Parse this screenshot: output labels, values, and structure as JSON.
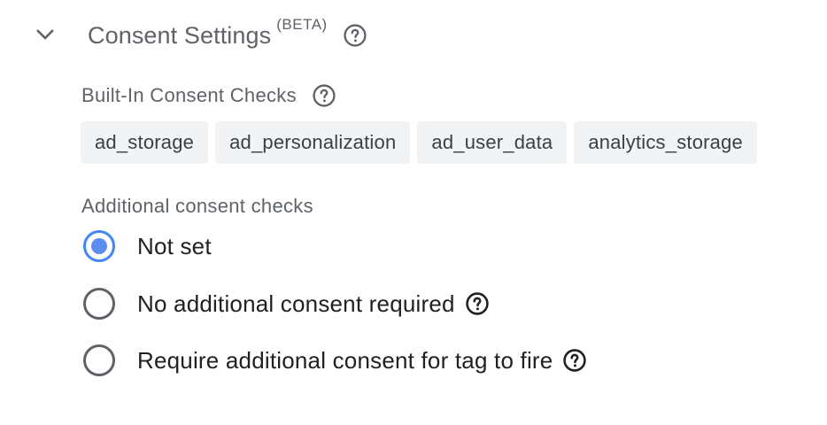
{
  "section": {
    "title": "Consent Settings",
    "badge": "(BETA)",
    "expand_icon": "chevron-down-icon",
    "help_icon": "help-circle-icon"
  },
  "built_in": {
    "label": "Built-In Consent Checks",
    "help_icon": "help-circle-icon",
    "chips": [
      "ad_storage",
      "ad_personalization",
      "ad_user_data",
      "analytics_storage"
    ]
  },
  "additional": {
    "label": "Additional consent checks",
    "options": [
      {
        "label": "Not set",
        "selected": true,
        "has_help": false
      },
      {
        "label": "No additional consent required",
        "selected": false,
        "has_help": true
      },
      {
        "label": "Require additional consent for tag to fire",
        "selected": false,
        "has_help": true
      }
    ]
  },
  "colors": {
    "accent": "#4285f4",
    "muted_text": "#5f6368",
    "chip_bg": "#f1f3f4"
  }
}
